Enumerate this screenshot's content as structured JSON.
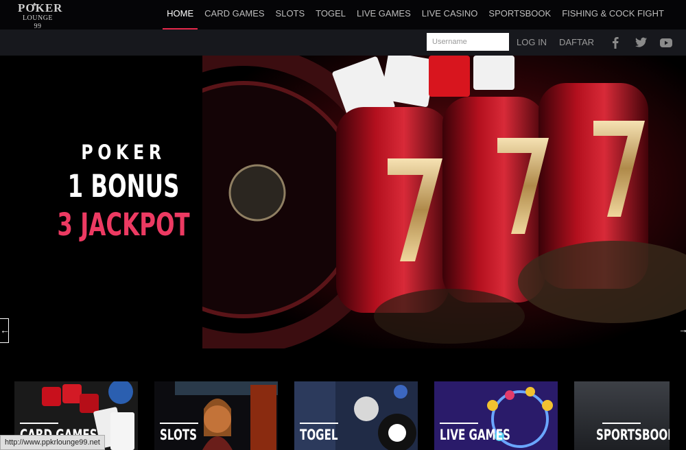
{
  "logo": {
    "line1": "POKER",
    "line2": "LOUNGE 99"
  },
  "nav": {
    "items": [
      {
        "label": "HOME"
      },
      {
        "label": "CARD GAMES"
      },
      {
        "label": "SLOTS"
      },
      {
        "label": "TOGEL"
      },
      {
        "label": "LIVE GAMES"
      },
      {
        "label": "LIVE CASINO"
      },
      {
        "label": "SPORTSBOOK"
      },
      {
        "label": "FISHING & COCK FIGHT"
      }
    ],
    "active": "HOME",
    "accent": "#e5284a"
  },
  "login": {
    "username_placeholder": "Username",
    "username_value": "",
    "login_label": "LOG IN",
    "daftar_label": "DAFTAR"
  },
  "social": {
    "icons": [
      "facebook-icon",
      "twitter-icon",
      "youtube-icon"
    ]
  },
  "hero": {
    "line1": "POKER",
    "line2": "1 BONUS",
    "line3": "3 JACKPOT",
    "highlight_color": "#ec3a62",
    "prev_arrow": "←",
    "next_arrow": "→"
  },
  "tiles": [
    {
      "label": "CARD GAMES"
    },
    {
      "label": "SLOTS"
    },
    {
      "label": "TOGEL"
    },
    {
      "label": "LIVE GAMES"
    },
    {
      "label": "SPORTSBOOK"
    }
  ],
  "status_bar": {
    "url": "http://www.ppkrlounge99.net"
  }
}
